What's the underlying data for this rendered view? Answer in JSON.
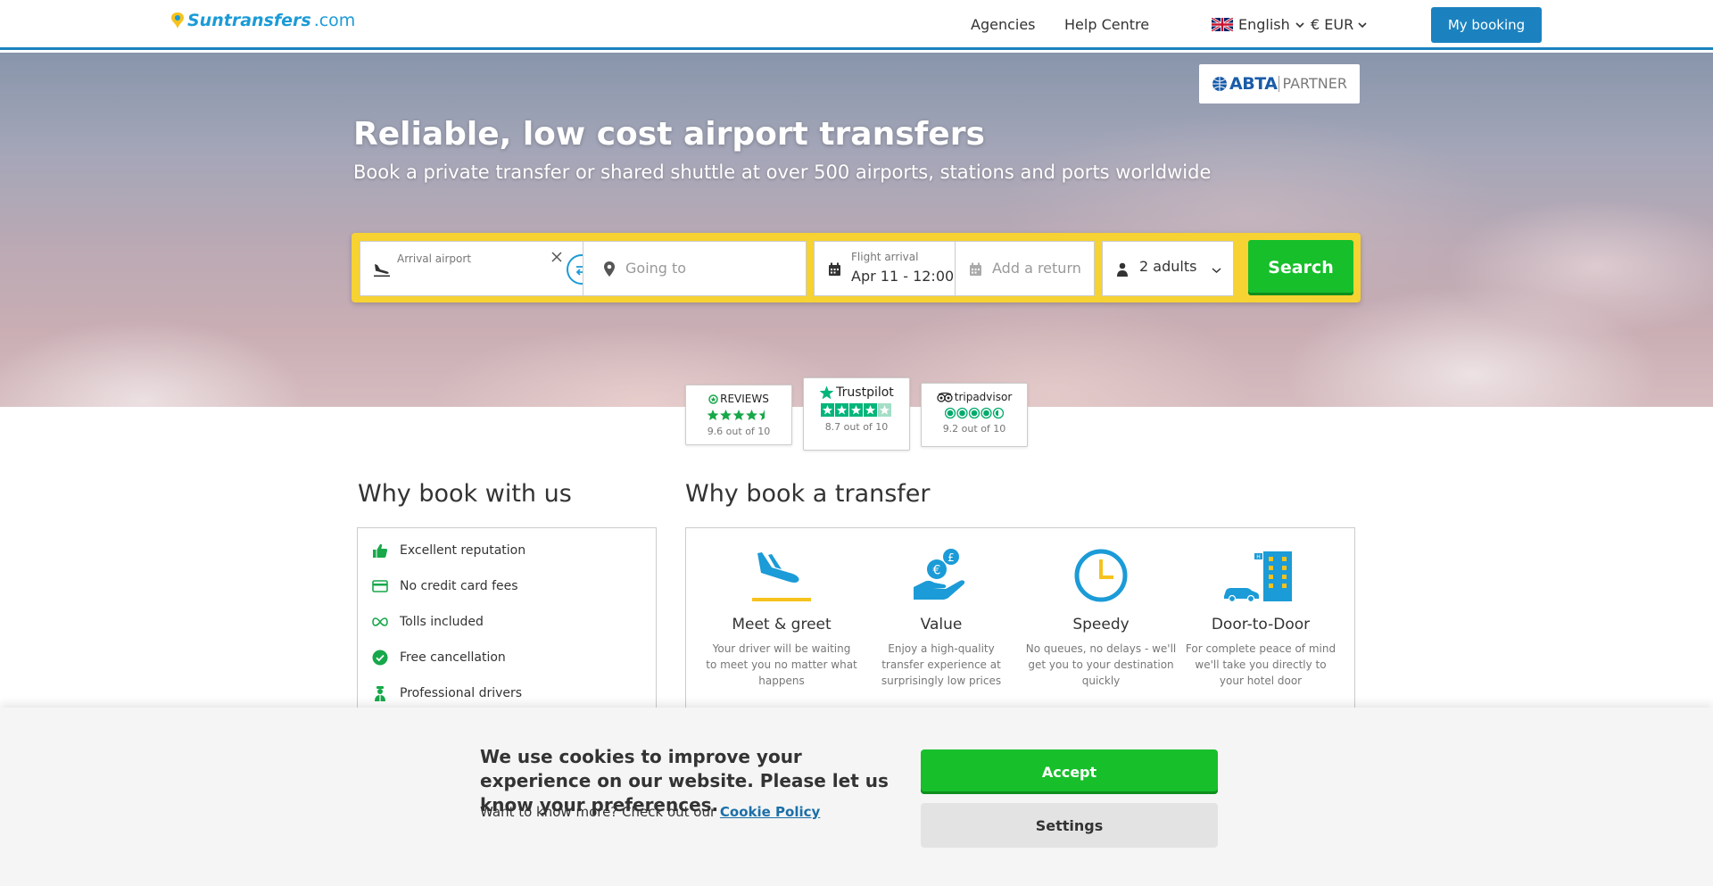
{
  "header": {
    "logo_text": "Suntransfers",
    "logo_suffix": ".com",
    "nav": [
      "Agencies",
      "Help Centre"
    ],
    "language": "English",
    "currency": "€ EUR",
    "my_booking": "My booking"
  },
  "hero": {
    "abta_main": "ABTA",
    "abta_partner": "PARTNER",
    "title": "Reliable, low cost airport transfers",
    "subtitle": "Book a private transfer or shared shuttle at over 500 airports, stations and ports worldwide"
  },
  "search": {
    "from_label": "Arrival airport",
    "to_placeholder": "Going to",
    "date_label": "Flight arrival",
    "date_value": "Apr 11 - 12:00",
    "return_placeholder": "Add a return",
    "passengers": "2 adults",
    "search_button": "Search"
  },
  "reviews": [
    {
      "name": "REVIEWS",
      "score": "9.6 out of 10"
    },
    {
      "name": "Trustpilot",
      "score": "8.7 out of 10"
    },
    {
      "name": "tripadvisor",
      "score": "9.2 out of 10"
    }
  ],
  "why_us": {
    "title": "Why book with us",
    "items": [
      {
        "label": "Excellent reputation",
        "icon": "thumbs-up-icon"
      },
      {
        "label": "No credit card fees",
        "icon": "credit-card-icon"
      },
      {
        "label": "Tolls included",
        "icon": "infinity-icon"
      },
      {
        "label": "Free cancellation",
        "icon": "check-circle-icon"
      },
      {
        "label": "Professional drivers",
        "icon": "driver-icon"
      }
    ]
  },
  "why_transfer": {
    "title": "Why book a transfer",
    "features": [
      {
        "title": "Meet & greet",
        "desc": "Your driver will be waiting to meet you no matter what happens",
        "icon": "plane-landing-icon"
      },
      {
        "title": "Value",
        "desc": "Enjoy a high-quality transfer experience at surprisingly low prices",
        "icon": "money-hand-icon"
      },
      {
        "title": "Speedy",
        "desc": "No queues, no delays - we'll get you to your destination quickly",
        "icon": "clock-icon"
      },
      {
        "title": "Door-to-Door",
        "desc": "For complete peace of mind we'll take you directly to your hotel door",
        "icon": "hotel-car-icon"
      }
    ]
  },
  "cookie": {
    "title": "We use cookies to improve your experience on our website. Please let us know your preferences.",
    "more_text": "Want to know more? Check out our",
    "link": "Cookie Policy",
    "accept": "Accept",
    "settings": "Settings"
  },
  "colors": {
    "brand_blue": "#1b82bf",
    "accent_yellow": "#f6d232",
    "cta_green": "#17bf2b",
    "icon_blue": "#1b9bd7"
  }
}
